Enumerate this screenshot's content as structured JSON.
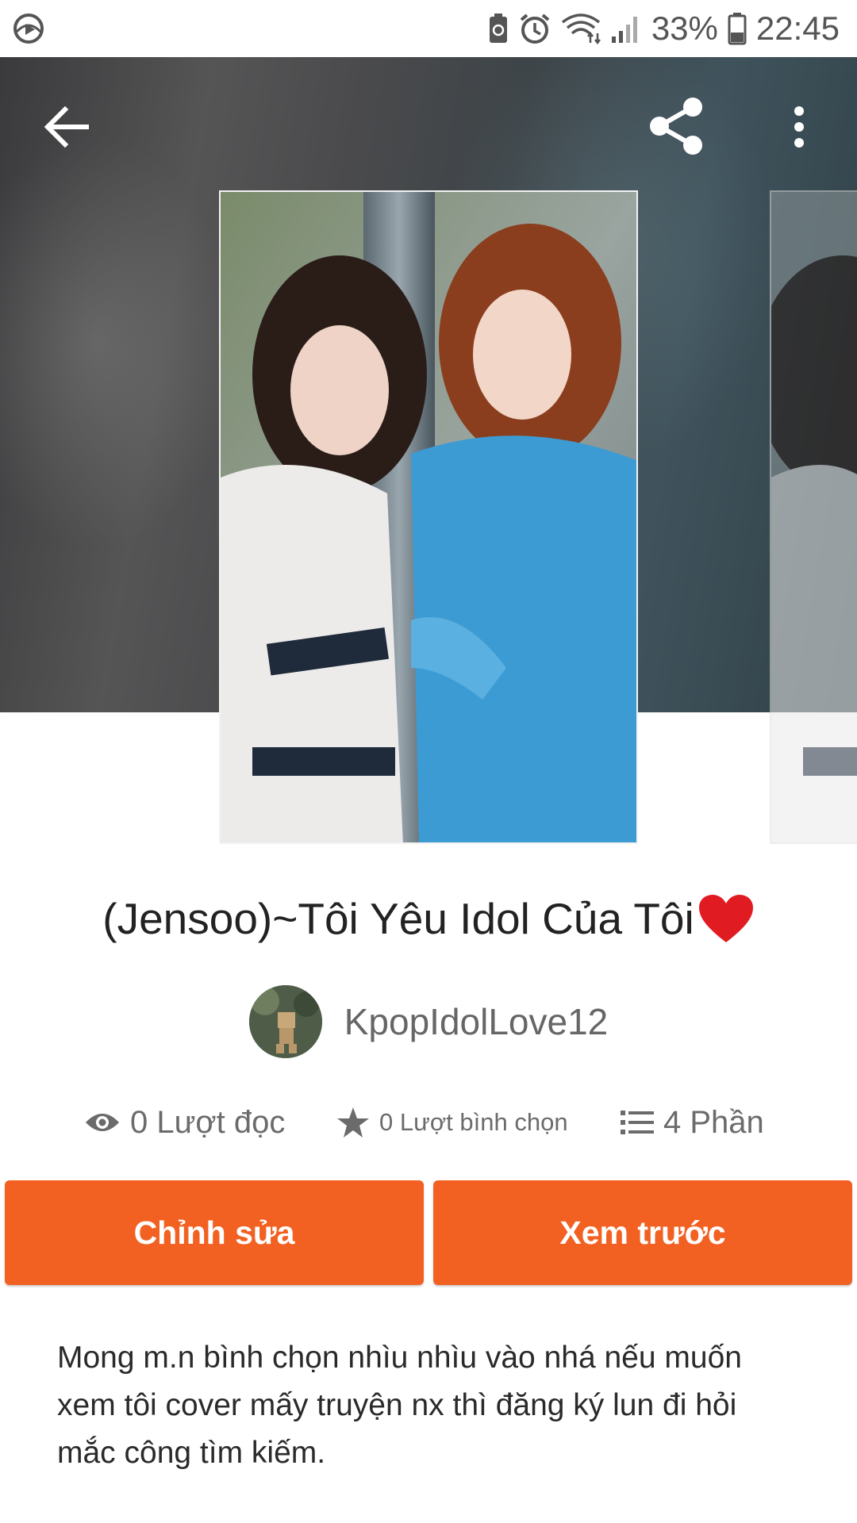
{
  "status_bar": {
    "battery_percent": "33%",
    "time": "22:45",
    "icons": [
      "media-app-icon",
      "battery-saver-icon",
      "alarm-icon",
      "wifi-icon",
      "signal-icon",
      "battery-icon"
    ]
  },
  "toolbar": {
    "back_icon": "arrow-left-icon",
    "share_icon": "share-icon",
    "more_icon": "more-vertical-icon"
  },
  "story": {
    "title": "(Jensoo)~Tôi Yêu Idol Của Tôi",
    "title_emoji": "❤",
    "author": "KpopIdolLove12",
    "stats": {
      "reads": "0 Lượt đọc",
      "votes": "0 Lượt bình chọn",
      "parts": "4 Phần"
    },
    "description": "Mong m.n bình chọn nhìu nhìu vào nhá nếu muốn xem tôi cover mấy truyện nx thì đăng ký lun đi hỏi mắc công tìm kiếm."
  },
  "actions": {
    "edit_label": "Chỉnh sửa",
    "preview_label": "Xem trước"
  },
  "colors": {
    "accent": "#f26122",
    "header_bg": "#3f4a50",
    "text_secondary": "#6b6b6b"
  }
}
